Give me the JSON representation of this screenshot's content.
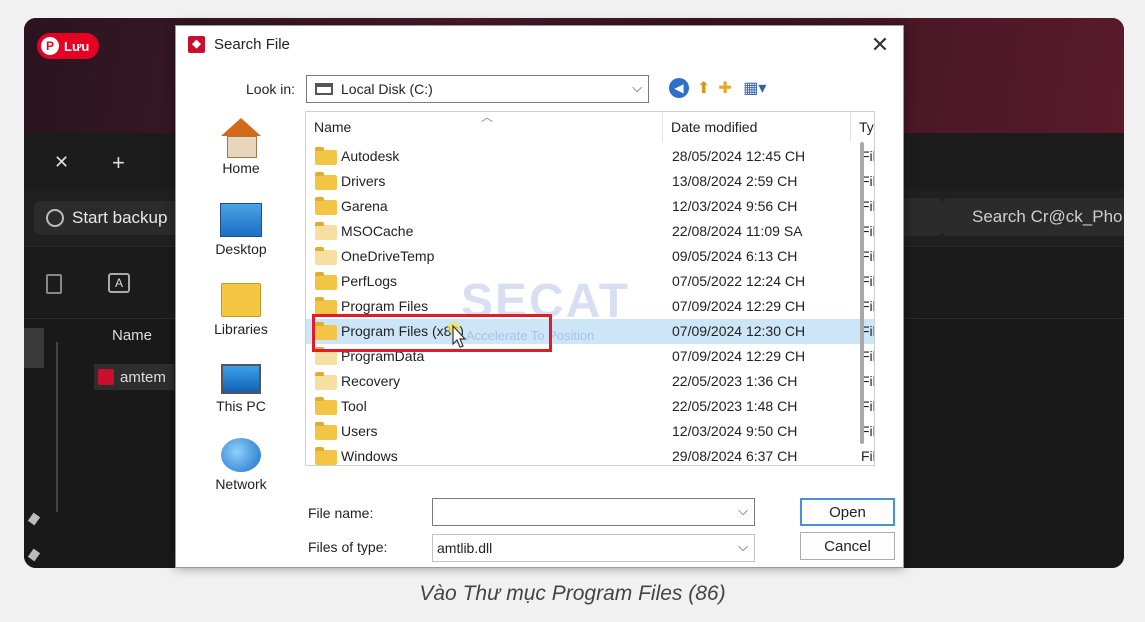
{
  "background_app": {
    "save_button": "Lưu",
    "start_backup": "Start backup",
    "search_placeholder": "Search Cr@ck_Pho",
    "name_header": "Name",
    "file_item": "amtem"
  },
  "dialog": {
    "title": "Search File",
    "look_in_label": "Look in:",
    "look_in_value": "Local Disk (C:)",
    "places": [
      {
        "label": "Home"
      },
      {
        "label": "Desktop"
      },
      {
        "label": "Libraries"
      },
      {
        "label": "This PC"
      },
      {
        "label": "Network"
      }
    ],
    "columns": {
      "name": "Name",
      "date": "Date modified",
      "type": "Ty"
    },
    "rows": [
      {
        "name": "Autodesk",
        "date": "28/05/2024 12:45 CH",
        "type": "Fil"
      },
      {
        "name": "Drivers",
        "date": "13/08/2024 2:59 CH",
        "type": "Fil"
      },
      {
        "name": "Garena",
        "date": "12/03/2024 9:56 CH",
        "type": "Fil"
      },
      {
        "name": "MSOCache",
        "date": "22/08/2024 11:09 SA",
        "type": "Fil"
      },
      {
        "name": "OneDriveTemp",
        "date": "09/05/2024 6:13 CH",
        "type": "Fil"
      },
      {
        "name": "PerfLogs",
        "date": "07/05/2022 12:24 CH",
        "type": "Fil"
      },
      {
        "name": "Program Files",
        "date": "07/09/2024 12:29 CH",
        "type": "Fil"
      },
      {
        "name": "Program Files (x86)",
        "date": "07/09/2024 12:30 CH",
        "type": "Fil"
      },
      {
        "name": "ProgramData",
        "date": "07/09/2024 12:29 CH",
        "type": "Fil"
      },
      {
        "name": "Recovery",
        "date": "22/05/2023 1:36 CH",
        "type": "Fil"
      },
      {
        "name": "Tool",
        "date": "22/05/2023 1:48 CH",
        "type": "Fil"
      },
      {
        "name": "Users",
        "date": "12/03/2024 9:50 CH",
        "type": "Fil"
      },
      {
        "name": "Windows",
        "date": "29/08/2024 6:37 CH",
        "type": "Fil"
      }
    ],
    "selected_row": 7,
    "file_name_label": "File name:",
    "file_name_value": "",
    "files_of_type_label": "Files of type:",
    "files_of_type_value": "amtlib.dll",
    "open_button": "Open",
    "cancel_button": "Cancel"
  },
  "watermark": {
    "brand": "SECAT",
    "tagline": "Accelerate To Position"
  },
  "caption": "Vào Thư mục Program Files (86)"
}
